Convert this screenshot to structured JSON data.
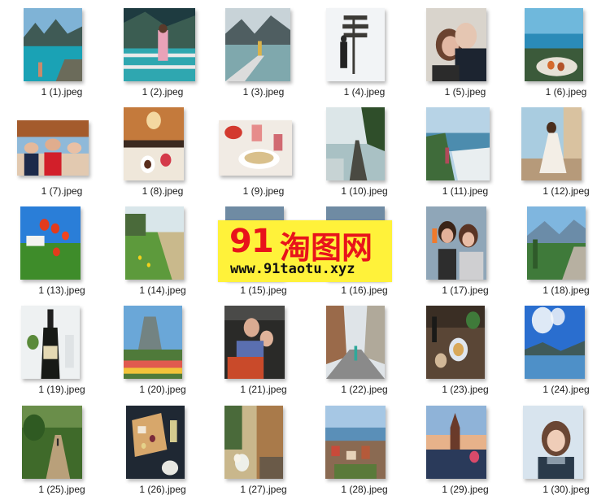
{
  "files": [
    {
      "name": "1 (1).jpeg",
      "scene": "lake-mountains"
    },
    {
      "name": "1 (2).jpeg",
      "scene": "lake-woman"
    },
    {
      "name": "1 (3).jpeg",
      "scene": "lake-pier"
    },
    {
      "name": "1 (4).jpeg",
      "scene": "snow-signpost"
    },
    {
      "name": "1 (5).jpeg",
      "scene": "couple"
    },
    {
      "name": "1 (6).jpeg",
      "scene": "seaside-food"
    },
    {
      "name": "1 (7).jpeg",
      "scene": "group-selfie"
    },
    {
      "name": "1 (8).jpeg",
      "scene": "restaurant"
    },
    {
      "name": "1 (9).jpeg",
      "scene": "table-food"
    },
    {
      "name": "1 (10).jpeg",
      "scene": "boardwalk"
    },
    {
      "name": "1 (11).jpeg",
      "scene": "coast"
    },
    {
      "name": "1 (12).jpeg",
      "scene": "woman-sitting"
    },
    {
      "name": "1 (13).jpeg",
      "scene": "poppies"
    },
    {
      "name": "1 (14).jpeg",
      "scene": "meadow"
    },
    {
      "name": "1 (15).jpeg",
      "scene": "hidden"
    },
    {
      "name": "1 (16).jpeg",
      "scene": "hidden"
    },
    {
      "name": "1 (17).jpeg",
      "scene": "women-drinks"
    },
    {
      "name": "1 (18).jpeg",
      "scene": "lake-garden"
    },
    {
      "name": "1 (19).jpeg",
      "scene": "champagne"
    },
    {
      "name": "1 (20).jpeg",
      "scene": "tulips"
    },
    {
      "name": "1 (21).jpeg",
      "scene": "couple-balcony"
    },
    {
      "name": "1 (22).jpeg",
      "scene": "street"
    },
    {
      "name": "1 (23).jpeg",
      "scene": "table-wine"
    },
    {
      "name": "1 (24).jpeg",
      "scene": "lake-sky"
    },
    {
      "name": "1 (25).jpeg",
      "scene": "forest-path"
    },
    {
      "name": "1 (26).jpeg",
      "scene": "cheese-board"
    },
    {
      "name": "1 (27).jpeg",
      "scene": "flowers-steps"
    },
    {
      "name": "1 (28).jpeg",
      "scene": "town-aerial"
    },
    {
      "name": "1 (29).jpeg",
      "scene": "church-sunset"
    },
    {
      "name": "1 (30).jpeg",
      "scene": "woman-portrait"
    }
  ],
  "watermark": {
    "number": "91",
    "chinese": "淘图网",
    "url": "www.91taotu.xyz"
  }
}
